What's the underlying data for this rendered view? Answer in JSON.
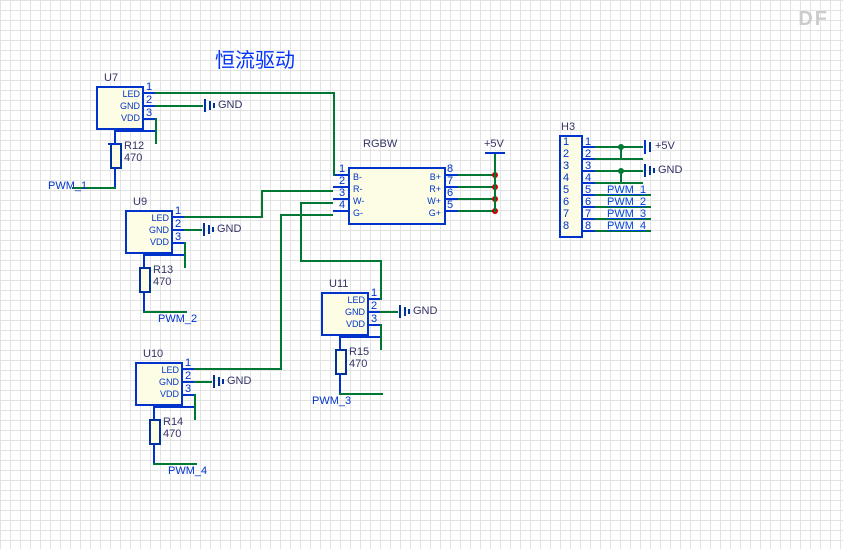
{
  "title": "恒流驱动",
  "watermark": "DF",
  "drivers": {
    "pins": {
      "p1": "LED",
      "p2": "GND",
      "p3": "VDD",
      "n1": "1",
      "n2": "2",
      "n3": "3"
    },
    "U7": {
      "ref": "U7",
      "res_ref": "R12",
      "res_val": "470",
      "pwm": "PWM_1",
      "gnd": "GND"
    },
    "U9": {
      "ref": "U9",
      "res_ref": "R13",
      "res_val": "470",
      "pwm": "PWM_2",
      "gnd": "GND"
    },
    "U10": {
      "ref": "U10",
      "res_ref": "R14",
      "res_val": "470",
      "pwm": "PWM_4",
      "gnd": "GND"
    },
    "U11": {
      "ref": "U11",
      "res_ref": "R15",
      "res_val": "470",
      "pwm": "PWM_3",
      "gnd": "GND"
    }
  },
  "rgbw": {
    "ref": "RGBW",
    "left": {
      "p1": "B-",
      "p2": "R-",
      "p3": "W-",
      "p4": "G-",
      "n1": "1",
      "n2": "2",
      "n3": "3",
      "n4": "4"
    },
    "right": {
      "p8": "B+",
      "p7": "R+",
      "p6": "W+",
      "p5": "G+",
      "n8": "8",
      "n7": "7",
      "n6": "6",
      "n5": "5"
    },
    "vcc": "+5V"
  },
  "header": {
    "ref": "H3",
    "nums": {
      "n1": "1",
      "n2": "2",
      "n3": "3",
      "n4": "4",
      "n5": "5",
      "n6": "6",
      "n7": "7",
      "n8": "8"
    },
    "vcc": "+5V",
    "gnd": "GND",
    "nets": {
      "p5": "PWM_1",
      "p6": "PWM_2",
      "p7": "PWM_3",
      "p8": "PWM_4"
    }
  }
}
